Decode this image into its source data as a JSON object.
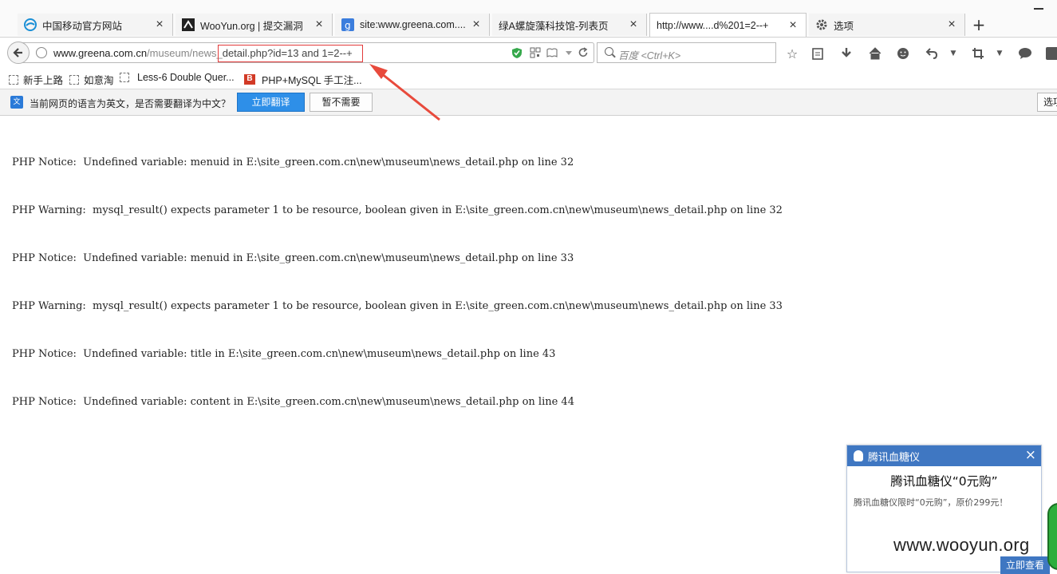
{
  "tabs": [
    {
      "title": "中国移动官方网站",
      "icon": "china-mobile-icon"
    },
    {
      "title": "WooYun.org | 提交漏洞",
      "icon": "wooyun-icon"
    },
    {
      "title": "site:www.greena.com....",
      "icon": "google-icon"
    },
    {
      "title": "绿A螺旋藻科技馆-列表页",
      "icon": "blank-page-icon"
    },
    {
      "title": "http://www....d%201=2--+",
      "icon": "blank-page-icon",
      "active": true
    },
    {
      "title": "选项",
      "icon": "gear-icon"
    }
  ],
  "address_bar": {
    "url_domain": "www.greena.com.cn",
    "url_path": "/museum/news_",
    "url_highlighted": "detail.php?id=13 and 1=2--+"
  },
  "search": {
    "placeholder": "百度 <Ctrl+K>"
  },
  "bookmarks": [
    {
      "label": "新手上路"
    },
    {
      "label": "如意淘"
    },
    {
      "label": "Less-6 Double Quer..."
    },
    {
      "label": "PHP+MySQL 手工注..."
    }
  ],
  "translate_bar": {
    "message": "当前网页的语言为英文，是否需要翻译为中文？",
    "translate_button": "立即翻译",
    "decline_button": "暂不需要",
    "options_button": "选项"
  },
  "page": {
    "lines": [
      "PHP Notice:  Undefined variable: menuid in E:\\site_green.com.cn\\new\\museum\\news_detail.php on line 32",
      "PHP Warning:  mysql_result() expects parameter 1 to be resource, boolean given in E:\\site_green.com.cn\\new\\museum\\news_detail.php on line 32",
      "PHP Notice:  Undefined variable: menuid in E:\\site_green.com.cn\\new\\museum\\news_detail.php on line 33",
      "PHP Warning:  mysql_result() expects parameter 1 to be resource, boolean given in E:\\site_green.com.cn\\new\\museum\\news_detail.php on line 33",
      "PHP Notice:  Undefined variable: title in E:\\site_green.com.cn\\new\\museum\\news_detail.php on line 43",
      "PHP Notice:  Undefined variable: content in E:\\site_green.com.cn\\new\\museum\\news_detail.php on line 44"
    ]
  },
  "popup": {
    "header": "腾讯血糖仪",
    "title": "腾讯血糖仪“0元购”",
    "description": "腾讯血糖仪限时“0元购”，原价299元！",
    "button": "立即查看"
  },
  "watermark": "www.wooyun.org",
  "colors": {
    "accent": "#2e8fe8",
    "annotation": "#e23b3b",
    "popup_header": "#3f77c2"
  }
}
